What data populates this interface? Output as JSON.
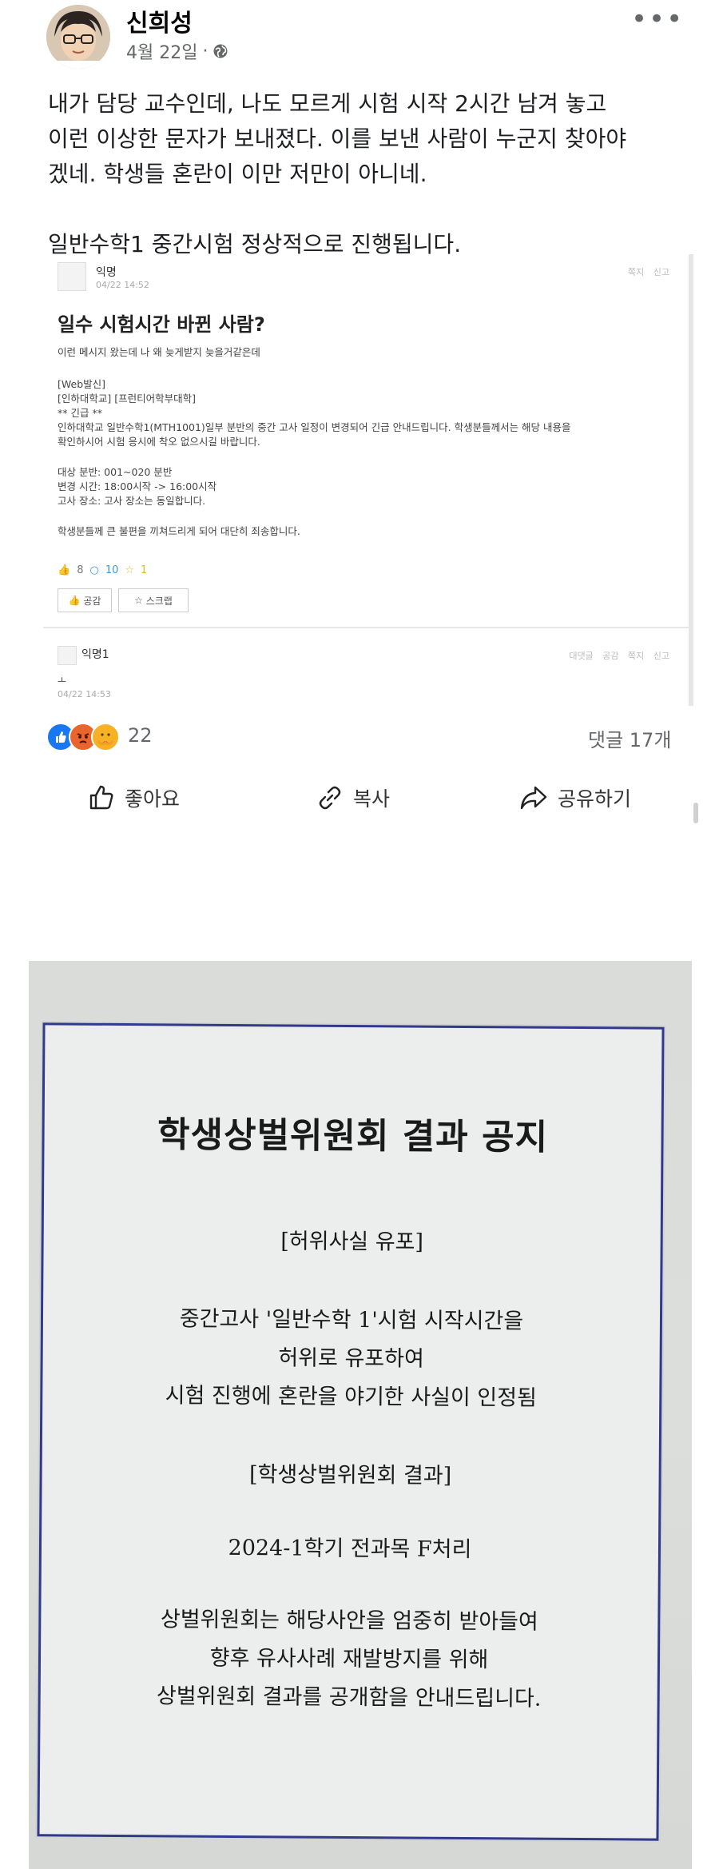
{
  "post": {
    "author": "신희성",
    "date": "4월 22일",
    "dot": "·",
    "more": "•••",
    "paragraph1": "내가 담당 교수인데, 나도 모르게 시험 시작 2시간 남겨 놓고\n이런 이상한 문자가 보내졌다. 이를 보낸 사람이 누군지 찾아야\n겠네. 학생들 혼란이 이만 저만이 아니네.",
    "paragraph2": "일반수학1 중간시험 정상적으로 진행됩니다."
  },
  "embedded": {
    "author": "익명",
    "date": "04/22 14:52",
    "actions": "쪽지 신고",
    "title": "일수 시험시간 바뀐 사람?",
    "lines": [
      "이런 메시지 왔는데 나 왜 늦게받지 늦을거같은데",
      "[Web발신]",
      "[인하대학교] [프런티어학부대학]",
      "** 긴급 **",
      "인하대학교 일반수학1(MTH1001)일부 분반의 중간 고사 일정이 변경되어 긴급 안내드립니다. 학생분들께서는 해당 내용을",
      "확인하시어 시험 응시에 착오 없으시길 바랍니다.",
      "대상 분반: 001~020 분반",
      "변경 시간: 18:00시작 -> 16:00시작",
      "고사 장소: 고사 장소는 동일합니다.",
      "학생분들께 큰 불편을 끼쳐드리게 되어 대단히 죄송합니다."
    ],
    "stats": {
      "likes": "8",
      "comments": "10",
      "scraps": "1"
    },
    "like_btn": "공감",
    "scrap_btn": "스크랩",
    "comment": {
      "author": "익명1",
      "actions": "대댓글 공감 쪽지 신고",
      "body": "ㅗ",
      "date": "04/22 14:53"
    }
  },
  "reactions": {
    "count": "22",
    "comments": "댓글 17개"
  },
  "actions": {
    "like": "좋아요",
    "copy": "복사",
    "share": "공유하기"
  },
  "notice": {
    "title": "학생상벌위원회 결과 공지",
    "section1": "[허위사실 유포]",
    "body1": [
      "중간고사 '일반수학 1'시험 시작시간을",
      "허위로 유포하여",
      "시험 진행에 혼란을 야기한 사실이 인정됨"
    ],
    "section2": "[학생상벌위원회 결과]",
    "result": "2024-1학기 전과목 F처리",
    "body2": [
      "상벌위원회는 해당사안을 엄중히 받아들여",
      "향후 유사사례 재발방지를 위해",
      "상벌위원회 결과를 공개함을 안내드립니다."
    ]
  },
  "colors": {
    "fb_gray": "#65676b",
    "like_blue": "#1877f2",
    "angry": "#e8652b",
    "care": "#f7b125",
    "notice_border": "#31398c"
  }
}
